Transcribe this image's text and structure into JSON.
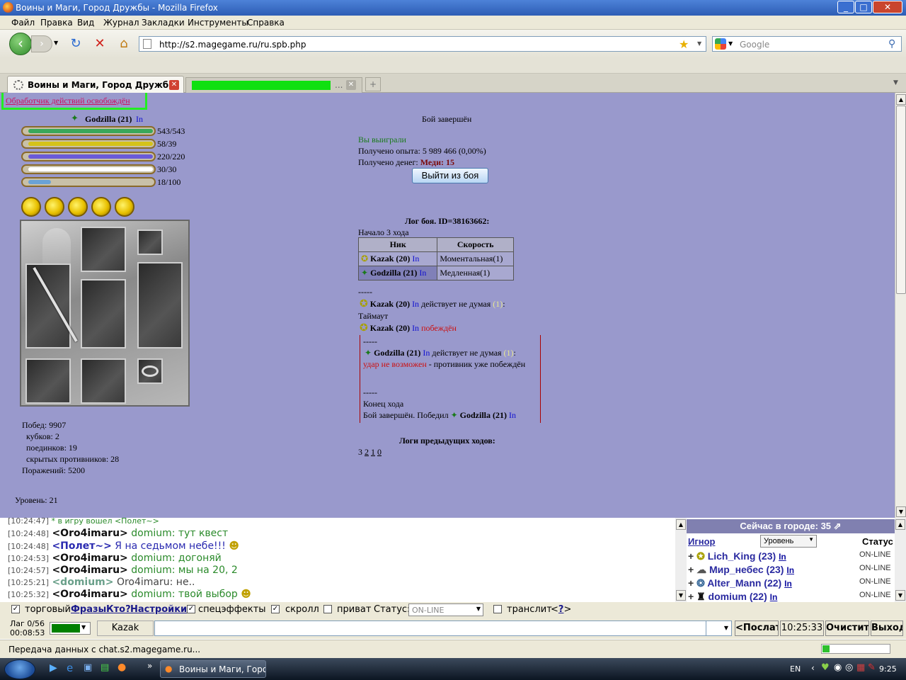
{
  "window": {
    "title": "Воины и Маги, Город Дружбы - Mozilla Firefox"
  },
  "menu": [
    "Файл",
    "Правка",
    "Вид",
    "Журнал",
    "Закладки",
    "Инструменты",
    "Справка"
  ],
  "nav": {
    "url": "http://s2.magegame.ru/ru.spb.php",
    "search_placeholder": "Google"
  },
  "tabs": {
    "active": "Воины и Маги, Город Дружбы",
    "second_ellipsis": "..."
  },
  "page": {
    "handler_link": "Обработчик действий освобождён",
    "player": {
      "name": "Godzilla (21)",
      "in_link": "In"
    },
    "bars": [
      {
        "label": "543/543",
        "color": "#3aa85a",
        "fill": 1.0
      },
      {
        "label": "58/39",
        "color": "#d4c21a",
        "fill": 1.0
      },
      {
        "label": "220/220",
        "color": "#6a5ad8",
        "fill": 1.0
      },
      {
        "label": "30/30",
        "color": "#ffffff",
        "fill": 1.0
      },
      {
        "label": "18/100",
        "color": "#6aa2d6",
        "fill": 0.18
      }
    ],
    "stats": {
      "wins": "Побед: 9907",
      "cups": "кубков: 2",
      "duels": "поединков: 19",
      "hidden": "скрытых противников: 28",
      "losses": "Поражений: 5200",
      "level": "Уровень: 21"
    },
    "battle": {
      "status": "Бой завершён",
      "won": "Вы выиграли",
      "exp": "Получено опыта: 5 989 466 (0,00%)",
      "money_label": "Получено денег:",
      "money_value": "Меди: 15",
      "exit_button": "Выйти из боя",
      "log_title": "Лог боя. ID=38163662:",
      "turn_start": "Начало 3 хода",
      "table_head": [
        "Ник",
        "Скорость"
      ],
      "table_rows": [
        {
          "nick": "Kazak (20)",
          "in": "In",
          "speed": "Моментальная(1)"
        },
        {
          "nick": "Godzilla (21)",
          "in": "In",
          "speed": "Медленная(1)"
        }
      ],
      "sep": "-----",
      "e1_nick": "Kazak (20)",
      "e1_in": "In",
      "e1_text": "действует не думая",
      "e1_num": "(1)",
      "e1_colon": ":",
      "timeout": "Таймаут",
      "e2_nick": "Kazak (20)",
      "e2_in": "In",
      "e2_text": "побеждён",
      "e3_nick": "Godzilla (21)",
      "e3_in": "In",
      "e3_text": "действует не думая",
      "e3_num": "(1)",
      "e3_colon": ":",
      "e3_fail": "удар не возможен",
      "e3_rest": "- противник уже побеждён",
      "turn_end": "Конец хода",
      "finish_text": "Бой завершён. Победил",
      "finish_nick": "Godzilla (21)",
      "finish_in": "In",
      "prev_logs": "Логи предыдущих ходов:",
      "prev_current": "3",
      "prev_links": [
        "2",
        "1",
        "0"
      ]
    }
  },
  "chat": {
    "lines": [
      {
        "ts": "[10:24:47]",
        "nick": "",
        "text": "* в игру вошел <Полет~>"
      },
      {
        "ts": "[10:24:48]",
        "nick": "<Oro4imaru>",
        "text": "domium: тут квест"
      },
      {
        "ts": "[10:24:48]",
        "nick": "<Полет~>",
        "text": "Я на седьмом небе!!!"
      },
      {
        "ts": "[10:24:53]",
        "nick": "<Oro4imaru>",
        "text": "domium: догоняй"
      },
      {
        "ts": "[10:24:57]",
        "nick": "<Oro4imaru>",
        "text": "domium: мы на 20, 2"
      },
      {
        "ts": "[10:25:21]",
        "nick": "<domium>",
        "text": "Oro4imaru: не.."
      },
      {
        "ts": "[10:25:32]",
        "nick": "<Oro4imaru>",
        "text": "domium: твой выбор"
      }
    ]
  },
  "who": {
    "title": "Сейчас в городе: 35",
    "ignore": "Игнор",
    "sort": "Уровень",
    "status": "Статус",
    "users": [
      {
        "name": "Lich_King (23)",
        "in": "In",
        "state": "ON-LINE"
      },
      {
        "name": "Мир_небес (23)",
        "in": "In",
        "state": "ON-LINE"
      },
      {
        "name": "Alter_Mann (22)",
        "in": "In",
        "state": "ON-LINE"
      },
      {
        "name": "domium (22)",
        "in": "In",
        "state": "ON-LINE"
      }
    ]
  },
  "controls": {
    "trade": "торговый",
    "phrases": "Фразы",
    "who": "Кто?",
    "settings": "Настройки",
    "effects": "спецэффекты",
    "scroll": "скролл",
    "private": "приват",
    "status_label": "Статус:",
    "status_value": "ON-LINE",
    "translit": "транслит",
    "help_open": "<",
    "help": "?",
    "help_close": ">",
    "lag": "Лаг 0/56",
    "time_elapsed": "00:08:53",
    "recipient": "Kazak",
    "send": "<Послать",
    "clock": "10:25:33",
    "clear": "Очистить",
    "exit": "Выход"
  },
  "statusbar": {
    "text": "Передача данных с chat.s2.magegame.ru..."
  },
  "taskbar": {
    "task": "Воины и Маги, Город...",
    "lang": "EN",
    "time": "9:25"
  }
}
